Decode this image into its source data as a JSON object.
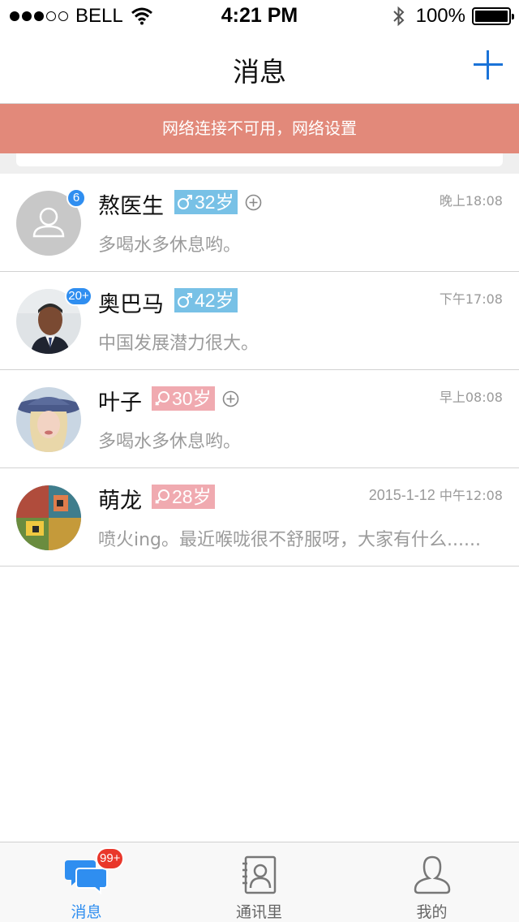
{
  "status_bar": {
    "carrier": "BELL",
    "time": "4:21 PM",
    "battery": "100%"
  },
  "nav": {
    "title": "消息"
  },
  "banner": {
    "text": "网络连接不可用，网络设置"
  },
  "chats": [
    {
      "name": "熬医生",
      "gender": "male",
      "age": "32岁",
      "time": "晚上18:08",
      "preview": "多喝水多休息哟。",
      "badge": "6"
    },
    {
      "name": "奥巴马",
      "gender": "male",
      "age": "42岁",
      "time": "下午17:08",
      "preview": "中国发展潜力很大。",
      "badge": "20+"
    },
    {
      "name": "叶子",
      "gender": "female",
      "age": "30岁",
      "time": "早上08:08",
      "preview": "多喝水多休息哟。"
    },
    {
      "name": "萌龙",
      "gender": "female",
      "age": "28岁",
      "time_date": "2015-1-12",
      "time": "中午12:08",
      "preview": "喷火ing。最近喉咙很不舒服呀，大家有什么......"
    }
  ],
  "tab_bar": {
    "tabs": [
      {
        "label": "消息",
        "badge": "99+"
      },
      {
        "label": "通讯里"
      },
      {
        "label": "我的"
      }
    ]
  },
  "colors": {
    "accent": "#2f8ef0",
    "banner": "#e2897a",
    "male_tag": "#78c1e6",
    "female_tag": "#f0aab0",
    "tab_badge": "#e9372b"
  }
}
